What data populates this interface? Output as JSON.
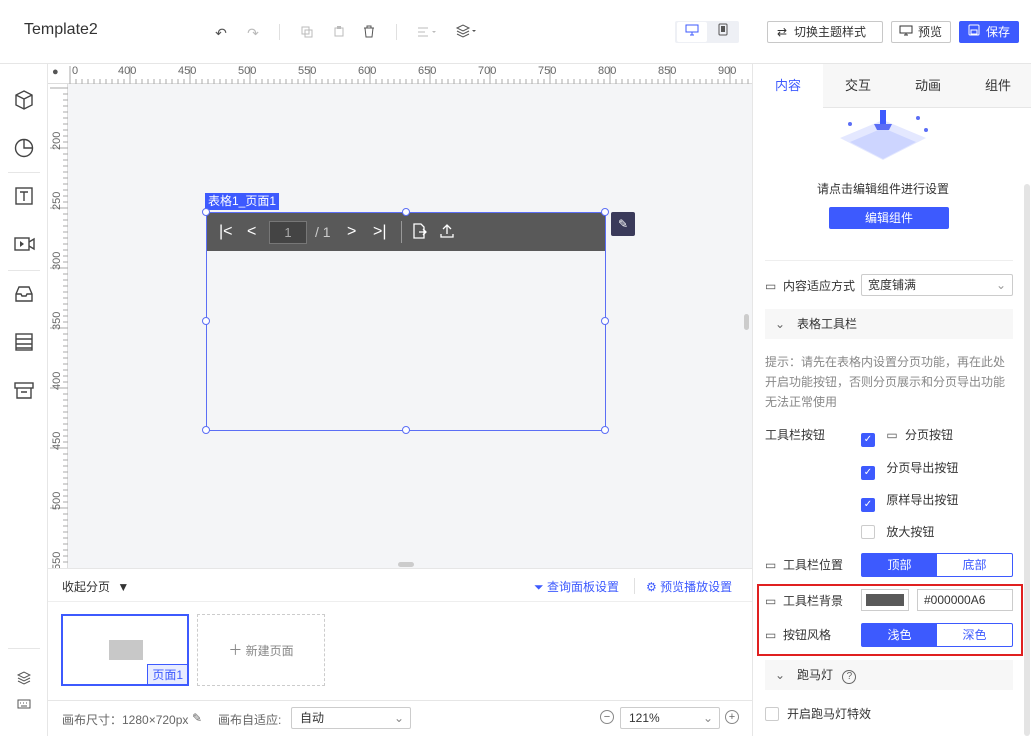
{
  "app": {
    "title": "Template2"
  },
  "toolbar": {
    "undo_icon": "↶",
    "redo_icon": "↷",
    "switch_theme": "切换主题样式",
    "preview": "预览",
    "save": "保存"
  },
  "ruler": {
    "top": [
      "0",
      "400",
      "450",
      "500",
      "550",
      "600",
      "650",
      "700",
      "750",
      "800",
      "850",
      "900"
    ],
    "left": [
      "200",
      "250",
      "300",
      "350",
      "400",
      "450",
      "500",
      "550"
    ]
  },
  "canvas": {
    "selected_tag": "表格1_页面1",
    "pager_current": "1",
    "pager_total": "/ 1"
  },
  "pages": {
    "collapse": "收起分页",
    "query_panel": "查询面板设置",
    "preview_play": "预览播放设置",
    "items": [
      {
        "label": "页面1"
      }
    ],
    "new_page": "新建页面"
  },
  "status": {
    "canvas_size": "画布尺寸：1280×720px",
    "auto_fit_label": "画布自适应:",
    "auto_fit_value": "自动",
    "zoom": "121%"
  },
  "right_panel": {
    "tabs": [
      {
        "label": "内容"
      },
      {
        "label": "交互"
      },
      {
        "label": "动画"
      },
      {
        "label": "组件"
      }
    ],
    "hint": "请点击编辑组件进行设置",
    "edit_component": "编辑组件",
    "fit_mode_label": "内容适应方式",
    "fit_mode_value": "宽度铺满",
    "table_toolbar_section": "表格工具栏",
    "tip": "提示：请先在表格内设置分页功能，再在此处开启功能按钮，否则分页展示和分页导出功能无法正常使用",
    "toolbar_buttons_label": "工具栏按钮",
    "checkboxes": [
      {
        "label": "分页按钮",
        "checked": true
      },
      {
        "label": "分页导出按钮",
        "checked": true
      },
      {
        "label": "原样导出按钮",
        "checked": true
      },
      {
        "label": "放大按钮",
        "checked": false
      }
    ],
    "toolbar_position_label": "工具栏位置",
    "position_options": [
      "顶部",
      "底部"
    ],
    "toolbar_bg_label": "工具栏背景",
    "toolbar_bg_value": "#000000A6",
    "button_style_label": "按钮风格",
    "style_options": [
      "浅色",
      "深色"
    ],
    "marquee_section": "跑马灯",
    "marquee_toggle": "开启跑马灯特效"
  },
  "colors": {
    "accent": "#3d5afe",
    "toolbar_bg": "#595959",
    "highlight": "#e02020"
  }
}
